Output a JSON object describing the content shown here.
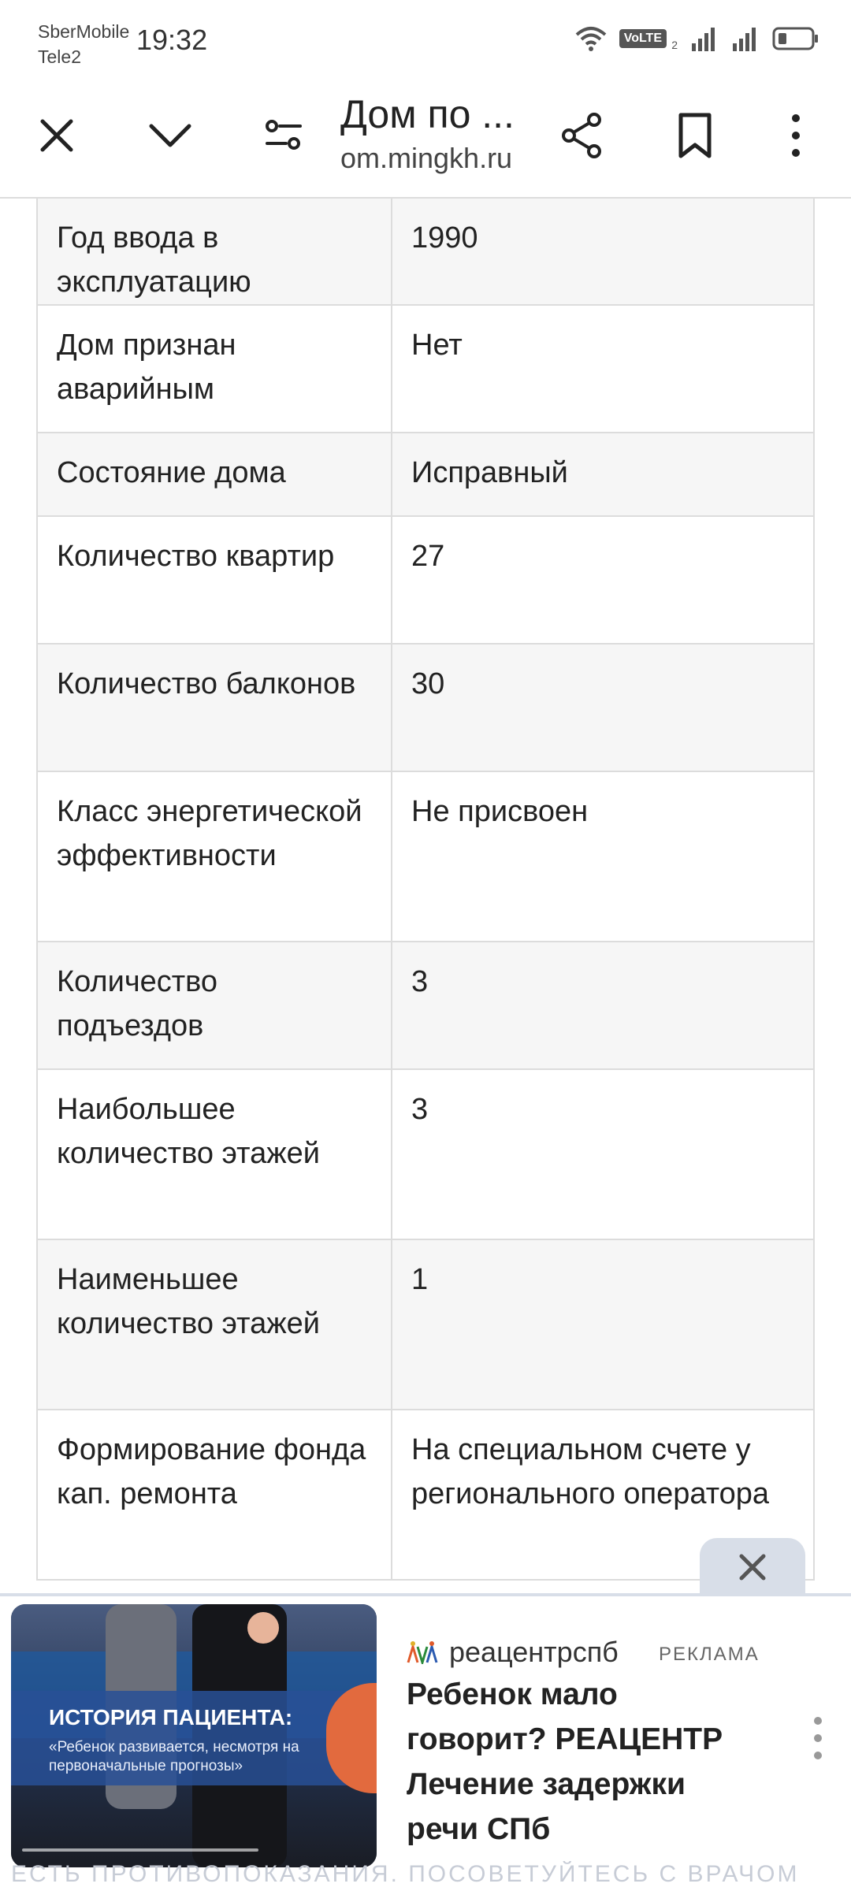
{
  "status_bar": {
    "carrier1": "SberMobile",
    "carrier2": "Tele2",
    "time": "19:32",
    "volte": "VoLTE",
    "volte_sub": "2"
  },
  "toolbar": {
    "page_title": "Дом по ...",
    "page_url": "om.mingkh.ru",
    "icons": [
      "close-icon",
      "chevron-down-icon",
      "filter-icon",
      "share-icon",
      "bookmark-icon",
      "more-vertical-icon"
    ]
  },
  "table": {
    "rows": [
      {
        "k": "Год ввода в эксплуатацию",
        "v": "1990"
      },
      {
        "k": "Дом признан аварийным",
        "v": "Нет"
      },
      {
        "k": "Состояние дома",
        "v": "Исправный"
      },
      {
        "k": "Количество квартир",
        "v": "27"
      },
      {
        "k": "Количество балконов",
        "v": "30"
      },
      {
        "k": "Класс энергетической эффективности",
        "v": "Не присвоен"
      },
      {
        "k": "Количество подъездов",
        "v": "3"
      },
      {
        "k": "Наибольшее количество этажей",
        "v": "3"
      },
      {
        "k": "Наименьшее количество этажей",
        "v": "1"
      },
      {
        "k": "Формирование фонда кап. ремонта",
        "v": "На специальном счете у регионального оператора"
      }
    ]
  },
  "ad": {
    "image_title": "ИСТОРИЯ ПАЦИЕНТА:",
    "image_subtitle": "«Ребенок развивается, несмотря на первоначальные прогнозы»",
    "brand": "реацентрспб",
    "label": "РЕКЛАМА",
    "headline": "Ребенок мало говорит? РЕАЦЕНТР Лечение задержки речи СПб",
    "disclaimer": "ЕСТЬ ПРОТИВОПОКАЗАНИЯ. ПОСОВЕТУЙТЕСЬ С ВРАЧОМ"
  }
}
